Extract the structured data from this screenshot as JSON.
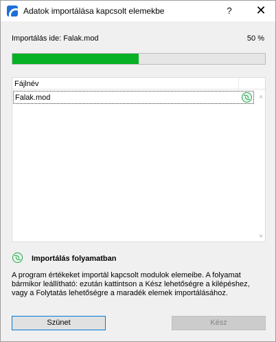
{
  "window": {
    "title": "Adatok importálása kapcsolt elemekbe",
    "help_label": "?",
    "close_label": "✕"
  },
  "progress": {
    "label": "Importálás ide: Falak.mod",
    "percent_text": "50 %",
    "value": 0.5,
    "color": "#06b025"
  },
  "list": {
    "header": "Fájlnév",
    "rows": [
      {
        "name": "Falak.mod",
        "icon": "sync-icon"
      }
    ],
    "scroll_up": "˄",
    "scroll_down": "˅"
  },
  "status": {
    "icon": "sync-icon",
    "title": "Importálás folyamatban",
    "description": "A program értékeket importál kapcsolt modulok elemeibe. A folyamat bármikor leállítható: ezután kattintson a Kész lehetőségre a kilépéshez, vagy a Folytatás lehetőségre a maradék elemek importálásához."
  },
  "buttons": {
    "pause": "Szünet",
    "done": "Kész"
  }
}
